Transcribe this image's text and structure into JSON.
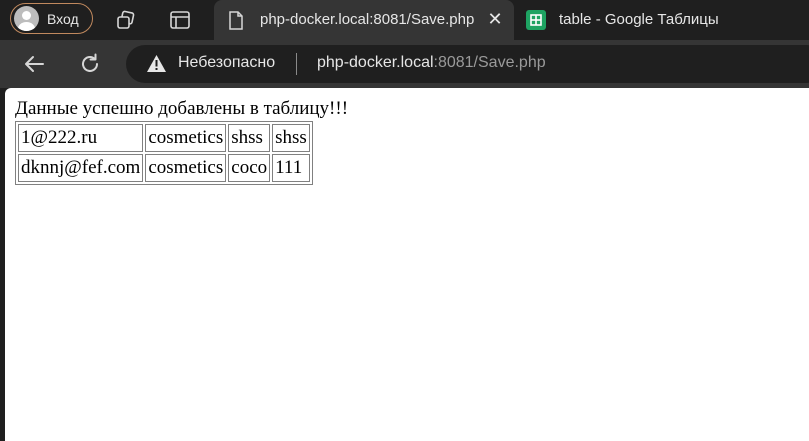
{
  "browser": {
    "profile_label": "Вход",
    "tabs": [
      {
        "title": "php-docker.local:8081/Save.php",
        "active": true,
        "icon": "document-icon"
      },
      {
        "title": "table - Google Таблицы",
        "active": false,
        "icon": "google-sheets-icon"
      }
    ],
    "security_label": "Небезопасно",
    "url_host": "php-docker.local",
    "url_rest": ":8081/Save.php",
    "colors": {
      "sheets_green": "#1ea362",
      "profile_border": "#c0895e"
    }
  },
  "page": {
    "message": "Данные успешно добавлены в таблицу!!!",
    "rows": [
      [
        "1@222.ru",
        "cosmetics",
        "shss",
        "shss"
      ],
      [
        "dknnj@fef.com",
        "cosmetics",
        "coco",
        "111"
      ]
    ]
  }
}
